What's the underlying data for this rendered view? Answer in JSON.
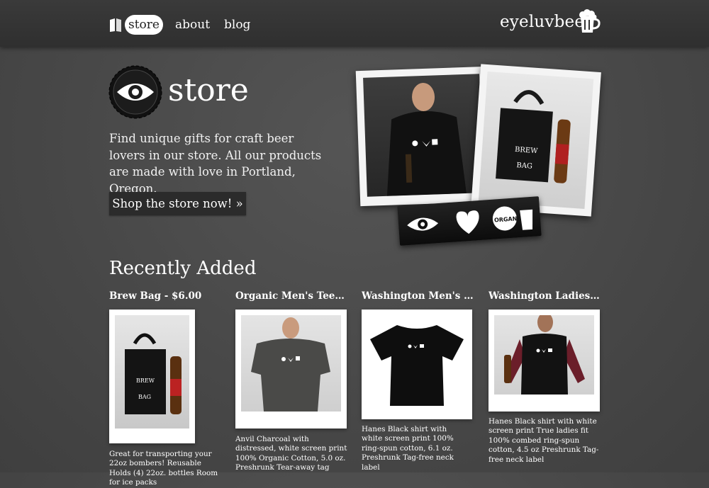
{
  "nav": {
    "items": [
      {
        "label": "store",
        "active": true
      },
      {
        "label": "about",
        "active": false
      },
      {
        "label": "blog",
        "active": false
      }
    ],
    "icon": "book-icon"
  },
  "brand": {
    "label": "eyeluvbeer",
    "icon": "beer-mug-icon"
  },
  "hero": {
    "title": "store",
    "intro": "Find unique gifts for craft beer lovers in our store. All our products are made with love in Portland, Oregon.",
    "cta_label": "Shop the store now! »",
    "logo_icon": "bottle-cap-eye-icon"
  },
  "recent": {
    "title": "Recently Added",
    "products": [
      {
        "title": "Brew Bag - $6.00",
        "description": "Great for transporting your 22oz bombers! Reusable Holds (4) 22oz. bottles Room for ice packs",
        "image": "brew-bag-photo"
      },
      {
        "title": "Organic Men's Tee - $...",
        "description": "Anvil Charcoal with distressed, white screen print 100% Organic Cotton, 5.0 oz. Preshrunk Tear-away tag",
        "image": "charcoal-tee-photo"
      },
      {
        "title": "Washington Men's Te...",
        "description": "Hanes Black shirt with white screen print 100% ring-spun cotton, 6.1 oz. Preshrunk Tag-free neck label",
        "image": "black-tee-photo"
      },
      {
        "title": "Washington Ladies Te...",
        "description": "Hanes Black shirt with white screen print True ladies fit 100% combed ring-spun cotton, 4.5 oz Preshrunk Tag-free neck label",
        "image": "ladies-tee-photo"
      }
    ]
  },
  "colors": {
    "background": "#4a4a4a",
    "topbar": "#333333",
    "cta": "#2b2b2b",
    "sticker_text": "ORGANIC"
  }
}
